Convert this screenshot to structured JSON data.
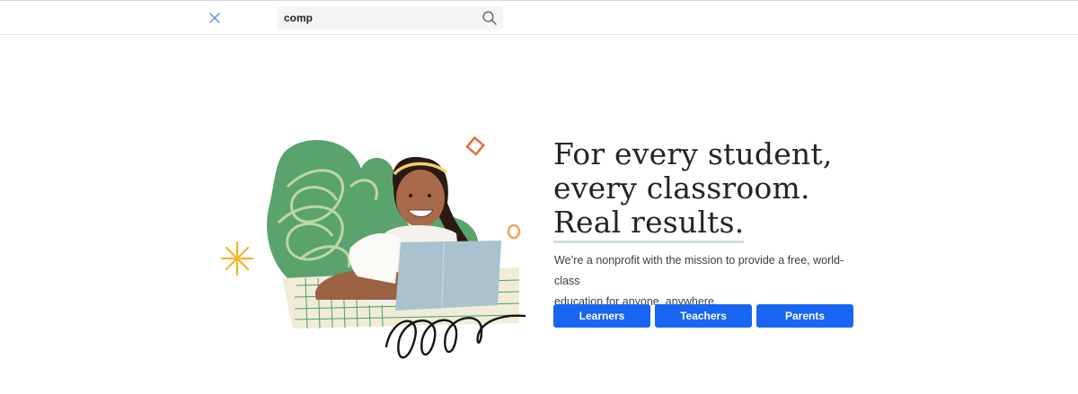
{
  "header": {
    "close_icon": "close-icon",
    "search": {
      "value": "comp",
      "icon": "search-icon"
    }
  },
  "hero": {
    "title_lines": [
      "For every student,",
      "every classroom.",
      "Real results."
    ],
    "description_lines": [
      "We’re a nonprofit with the mission to provide a free, world-class",
      "education for anyone, anywhere."
    ],
    "buttons": [
      {
        "label": "Learners"
      },
      {
        "label": "Teachers"
      },
      {
        "label": "Parents"
      }
    ]
  },
  "colors": {
    "primary_button": "#1865f2",
    "title_text": "#21242c",
    "underline": "#cde3e0",
    "leaf_green": "#5aa36d",
    "star_yellow": "#f2b523",
    "diamond_orange": "#e96b3b",
    "tablet_blue": "#a9c2cd"
  }
}
